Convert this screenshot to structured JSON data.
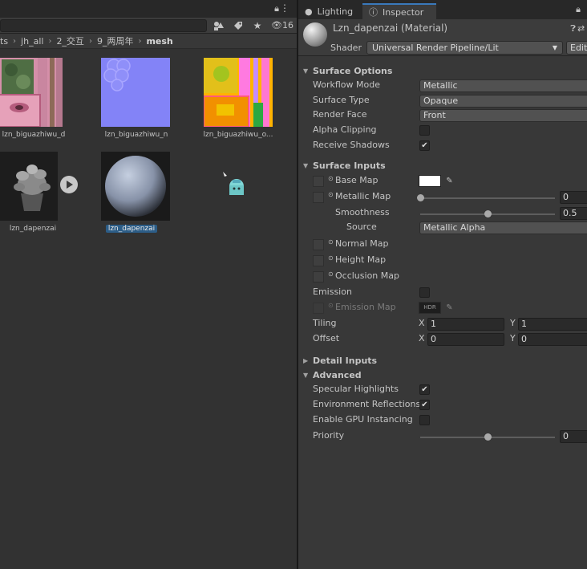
{
  "project": {
    "filter_count": "16",
    "breadcrumb": [
      "ts",
      "jh_all",
      "2_交互",
      "9_两周年",
      "mesh"
    ],
    "assets": [
      {
        "label": "lzn_biguazhiwu_d",
        "selected": false
      },
      {
        "label": "lzn_biguazhiwu_n",
        "selected": false
      },
      {
        "label": "lzn_biguazhiwu_o...",
        "selected": false
      },
      {
        "label": "lzn_dapenzai",
        "selected": false
      },
      {
        "label": "lzn_dapenzai",
        "selected": true
      }
    ]
  },
  "inspector": {
    "tabs": [
      {
        "label": "Lighting",
        "icon": "lightbulb-icon"
      },
      {
        "label": "Inspector",
        "icon": "info-icon"
      }
    ],
    "material_title": "Lzn_dapenzai (Material)",
    "shader_label": "Shader",
    "shader_value": "Universal Render Pipeline/Lit",
    "edit_label": "Edit..."
  },
  "surface_options": {
    "title": "Surface Options",
    "workflow_mode": {
      "label": "Workflow Mode",
      "value": "Metallic"
    },
    "surface_type": {
      "label": "Surface Type",
      "value": "Opaque"
    },
    "render_face": {
      "label": "Render Face",
      "value": "Front"
    },
    "alpha_clipping": {
      "label": "Alpha Clipping",
      "checked": false
    },
    "receive_shadows": {
      "label": "Receive Shadows",
      "checked": true
    }
  },
  "surface_inputs": {
    "title": "Surface Inputs",
    "base_map": {
      "label": "Base Map",
      "color": "#ffffff"
    },
    "metallic_map": {
      "label": "Metallic Map",
      "value": "0",
      "fraction": 0.0
    },
    "smoothness": {
      "label": "Smoothness",
      "value": "0.5",
      "fraction": 0.5
    },
    "source": {
      "label": "Source",
      "value": "Metallic Alpha"
    },
    "normal_map": {
      "label": "Normal Map"
    },
    "height_map": {
      "label": "Height Map"
    },
    "occlusion_map": {
      "label": "Occlusion Map"
    },
    "emission": {
      "label": "Emission",
      "checked": false
    },
    "emission_map": {
      "label": "Emission Map",
      "hdr": "HDR"
    },
    "tiling": {
      "label": "Tiling",
      "x": "1",
      "y": "1"
    },
    "offset": {
      "label": "Offset",
      "x": "0",
      "y": "0"
    },
    "axis_x": "X",
    "axis_y": "Y"
  },
  "detail_inputs": {
    "title": "Detail Inputs"
  },
  "advanced": {
    "title": "Advanced",
    "specular_highlights": {
      "label": "Specular Highlights",
      "checked": true
    },
    "environment_reflections": {
      "label": "Environment Reflections",
      "checked": true
    },
    "gpu_instancing": {
      "label": "Enable GPU Instancing",
      "checked": false
    },
    "priority": {
      "label": "Priority",
      "value": "0",
      "fraction": 0.5
    }
  }
}
